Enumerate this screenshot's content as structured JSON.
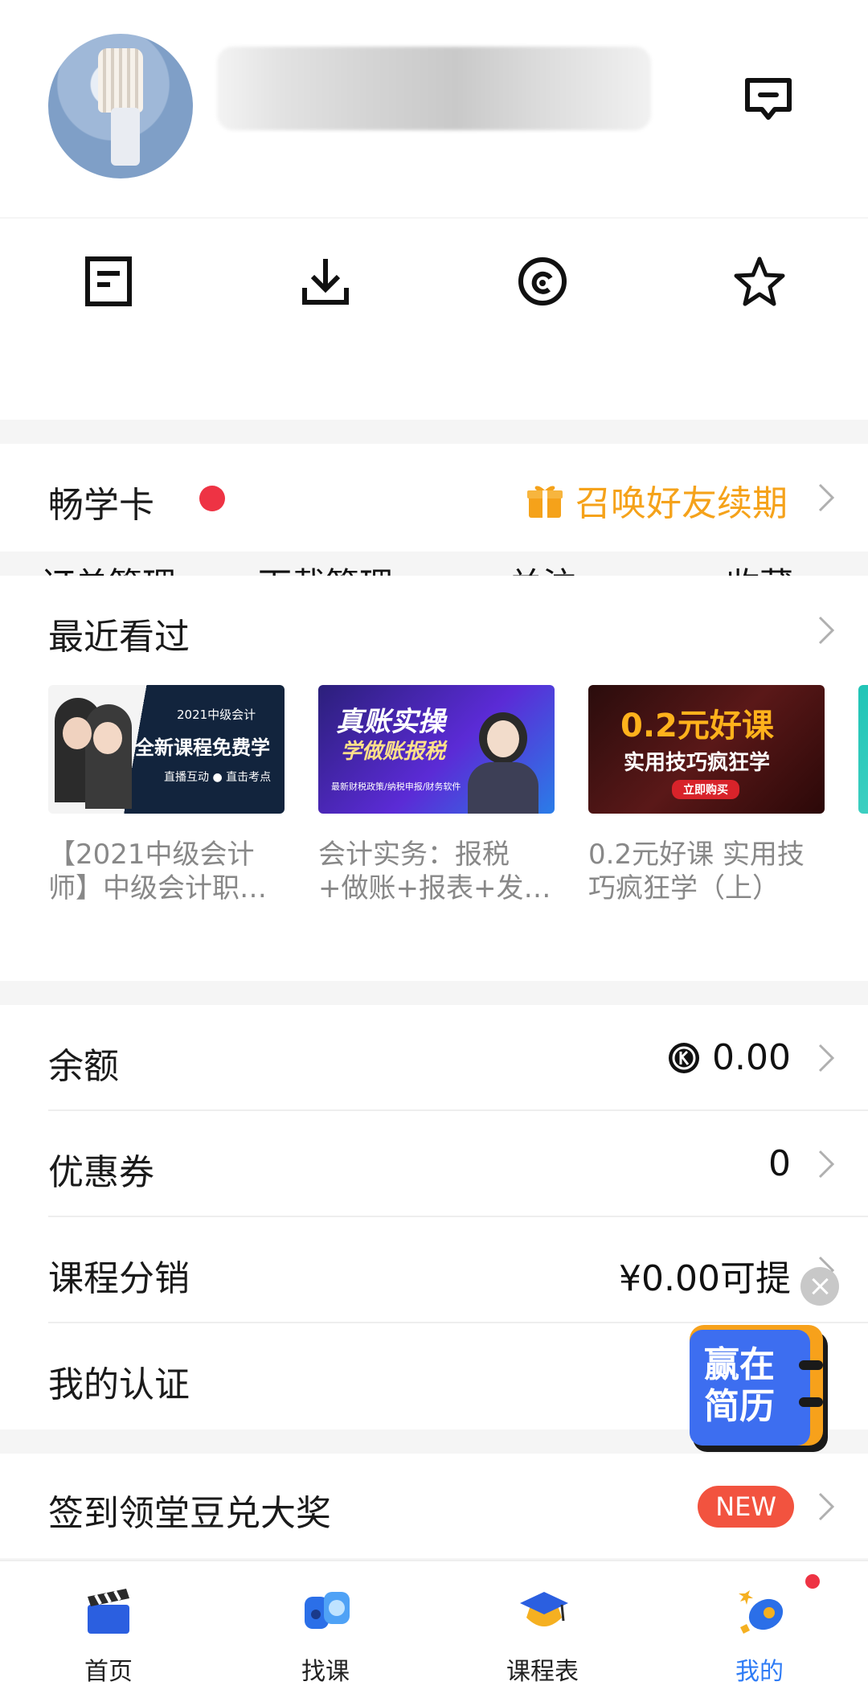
{
  "header": {
    "avatar_alt": "avatar",
    "username": ""
  },
  "quick_actions": [
    {
      "label": "订单管理",
      "icon": "order-icon"
    },
    {
      "label": "下载管理",
      "icon": "download-icon"
    },
    {
      "label": "关注",
      "icon": "follow-icon"
    },
    {
      "label": "收藏",
      "icon": "star-icon"
    }
  ],
  "card": {
    "title": "畅学卡",
    "promo": "召唤好友续期"
  },
  "recent": {
    "title": "最近看过",
    "items": [
      {
        "caption": "【2021中级会计师】中级会计职…",
        "img_title": "2021中级会计",
        "img_main": "全新课程免费学",
        "img_sub": "直播互动 ● 直击考点"
      },
      {
        "caption": "会计实务：报税+做账+报表+发…",
        "img_title": "真账实操",
        "img_main": "学做账报税",
        "img_sub": "最新财税政策/纳税申报/财务软件"
      },
      {
        "caption": "0.2元好课 实用技巧疯狂学（上）",
        "img_title": "0.2元好课",
        "img_main": "实用技巧疯狂学",
        "img_sub": "立即购买"
      }
    ]
  },
  "account": {
    "balance_label": "余额",
    "balance_value": "0.00",
    "coupon_label": "优惠券",
    "coupon_value": "0",
    "distribution_label": "课程分销",
    "distribution_value": "¥0.00可提",
    "cert_label": "我的认证"
  },
  "float_ad": {
    "line1": "赢在",
    "line2": "简历"
  },
  "signin": {
    "label": "签到领堂豆兑大奖",
    "badge": "NEW"
  },
  "tabs": [
    {
      "label": "首页",
      "active": false
    },
    {
      "label": "找课",
      "active": false
    },
    {
      "label": "课程表",
      "active": false
    },
    {
      "label": "我的",
      "active": true
    }
  ],
  "colors": {
    "accent": "#2f7cf6",
    "promo": "#f5a21a",
    "badge": "#f2533f",
    "reddot": "#ee3344"
  }
}
